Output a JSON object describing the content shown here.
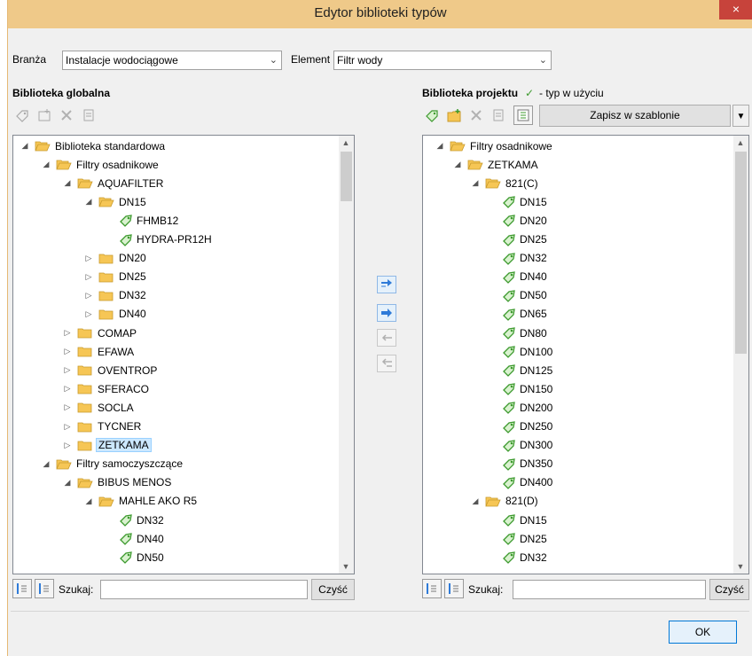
{
  "window": {
    "title": "Edytor biblioteki typów",
    "close_glyph": "×"
  },
  "filters": {
    "branza_label": "Branża",
    "branza_value": "Instalacje wodociągowe",
    "element_label": "Element",
    "element_value": "Filtr wody"
  },
  "left": {
    "title": "Biblioteka globalna",
    "search_label": "Szukaj:",
    "search_value": "",
    "clear_label": "Czyść",
    "tree": [
      {
        "label": "Biblioteka standardowa",
        "level": 0,
        "type": "folder",
        "state": "expanded"
      },
      {
        "label": "Filtry osadnikowe",
        "level": 1,
        "type": "folder",
        "state": "expanded"
      },
      {
        "label": "AQUAFILTER",
        "level": 2,
        "type": "folder",
        "state": "expanded"
      },
      {
        "label": "DN15",
        "level": 3,
        "type": "folder",
        "state": "expanded"
      },
      {
        "label": "FHMB12",
        "level": 4,
        "type": "item",
        "state": "leaf"
      },
      {
        "label": "HYDRA-PR12H",
        "level": 4,
        "type": "item",
        "state": "leaf"
      },
      {
        "label": "DN20",
        "level": 3,
        "type": "folder",
        "state": "collapsed"
      },
      {
        "label": "DN25",
        "level": 3,
        "type": "folder",
        "state": "collapsed"
      },
      {
        "label": "DN32",
        "level": 3,
        "type": "folder",
        "state": "collapsed"
      },
      {
        "label": "DN40",
        "level": 3,
        "type": "folder",
        "state": "collapsed"
      },
      {
        "label": "COMAP",
        "level": 2,
        "type": "folder",
        "state": "collapsed"
      },
      {
        "label": "EFAWA",
        "level": 2,
        "type": "folder",
        "state": "collapsed"
      },
      {
        "label": "OVENTROP",
        "level": 2,
        "type": "folder",
        "state": "collapsed"
      },
      {
        "label": "SFERACO",
        "level": 2,
        "type": "folder",
        "state": "collapsed"
      },
      {
        "label": "SOCLA",
        "level": 2,
        "type": "folder",
        "state": "collapsed"
      },
      {
        "label": "TYCNER",
        "level": 2,
        "type": "folder",
        "state": "collapsed"
      },
      {
        "label": "ZETKAMA",
        "level": 2,
        "type": "folder",
        "state": "collapsed",
        "selected": true
      },
      {
        "label": "Filtry samoczyszczące",
        "level": 1,
        "type": "folder",
        "state": "expanded"
      },
      {
        "label": "BIBUS MENOS",
        "level": 2,
        "type": "folder",
        "state": "expanded"
      },
      {
        "label": "MAHLE AKO R5",
        "level": 3,
        "type": "folder",
        "state": "expanded"
      },
      {
        "label": "DN32",
        "level": 4,
        "type": "item",
        "state": "leaf"
      },
      {
        "label": "DN40",
        "level": 4,
        "type": "item",
        "state": "leaf"
      },
      {
        "label": "DN50",
        "level": 4,
        "type": "item",
        "state": "leaf"
      }
    ]
  },
  "right": {
    "title": "Biblioteka projektu",
    "legend_check": "✓",
    "legend_text": "- typ w użyciu",
    "save_template_label": "Zapisz w szablonie",
    "search_label": "Szukaj:",
    "search_value": "",
    "clear_label": "Czyść",
    "tree": [
      {
        "label": "Filtry osadnikowe",
        "level": 0,
        "type": "folder",
        "state": "expanded"
      },
      {
        "label": "ZETKAMA",
        "level": 1,
        "type": "folder",
        "state": "expanded"
      },
      {
        "label": "821(C)",
        "level": 2,
        "type": "folder",
        "state": "expanded"
      },
      {
        "label": "DN15",
        "level": 3,
        "type": "item",
        "state": "leaf"
      },
      {
        "label": "DN20",
        "level": 3,
        "type": "item",
        "state": "leaf"
      },
      {
        "label": "DN25",
        "level": 3,
        "type": "item",
        "state": "leaf"
      },
      {
        "label": "DN32",
        "level": 3,
        "type": "item",
        "state": "leaf"
      },
      {
        "label": "DN40",
        "level": 3,
        "type": "item",
        "state": "leaf"
      },
      {
        "label": "DN50",
        "level": 3,
        "type": "item",
        "state": "leaf"
      },
      {
        "label": "DN65",
        "level": 3,
        "type": "item",
        "state": "leaf"
      },
      {
        "label": "DN80",
        "level": 3,
        "type": "item",
        "state": "leaf"
      },
      {
        "label": "DN100",
        "level": 3,
        "type": "item",
        "state": "leaf"
      },
      {
        "label": "DN125",
        "level": 3,
        "type": "item",
        "state": "leaf"
      },
      {
        "label": "DN150",
        "level": 3,
        "type": "item",
        "state": "leaf"
      },
      {
        "label": "DN200",
        "level": 3,
        "type": "item",
        "state": "leaf"
      },
      {
        "label": "DN250",
        "level": 3,
        "type": "item",
        "state": "leaf"
      },
      {
        "label": "DN300",
        "level": 3,
        "type": "item",
        "state": "leaf"
      },
      {
        "label": "DN350",
        "level": 3,
        "type": "item",
        "state": "leaf"
      },
      {
        "label": "DN400",
        "level": 3,
        "type": "item",
        "state": "leaf"
      },
      {
        "label": "821(D)",
        "level": 2,
        "type": "folder",
        "state": "expanded"
      },
      {
        "label": "DN15",
        "level": 3,
        "type": "item",
        "state": "leaf"
      },
      {
        "label": "DN25",
        "level": 3,
        "type": "item",
        "state": "leaf"
      },
      {
        "label": "DN32",
        "level": 3,
        "type": "item",
        "state": "leaf"
      }
    ]
  },
  "footer": {
    "ok_label": "OK"
  },
  "colors": {
    "titlebar": "#efc989",
    "close": "#c7433b",
    "folder": "#f6c655",
    "tag": "#3d9a2e",
    "selection": "#cce8ff",
    "arrow_blue": "#2f7bd8"
  }
}
